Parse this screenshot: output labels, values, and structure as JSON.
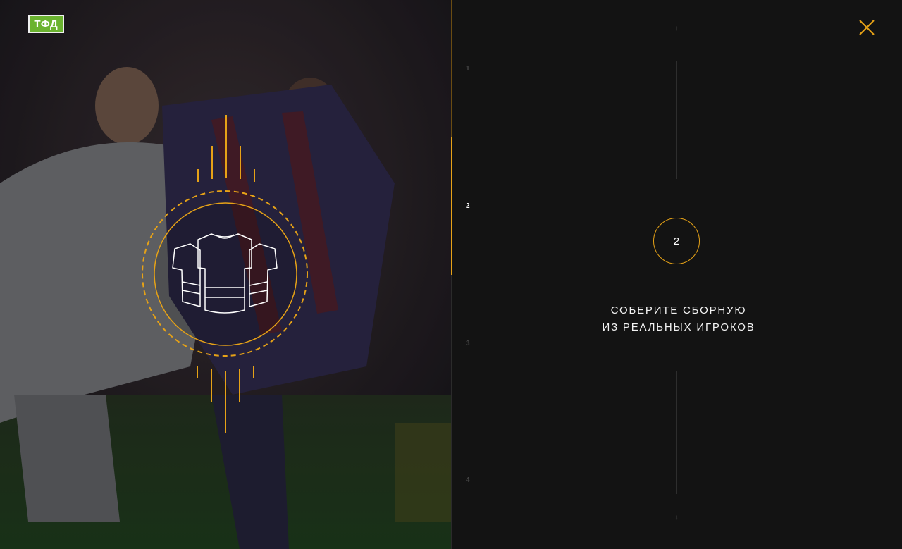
{
  "app": {
    "logo_text": "ТФД"
  },
  "steps": {
    "items": [
      {
        "number": "1"
      },
      {
        "number": "2"
      },
      {
        "number": "3"
      },
      {
        "number": "4"
      }
    ],
    "active_index": 2,
    "progress_fraction": 0.5
  },
  "current_step": {
    "badge": "2",
    "caption_line1": "СОБЕРИТЕ СБОРНУЮ",
    "caption_line2": "ИЗ РЕАЛЬНЫХ ИГРОКОВ"
  },
  "icons": {
    "close": "close-icon",
    "arrow_up": "arrow-up-icon",
    "arrow_down": "arrow-down-icon",
    "jersey": "jersey-icon"
  },
  "colors": {
    "accent": "#e6a217",
    "background": "#131313",
    "logo_green": "#6bb330"
  }
}
